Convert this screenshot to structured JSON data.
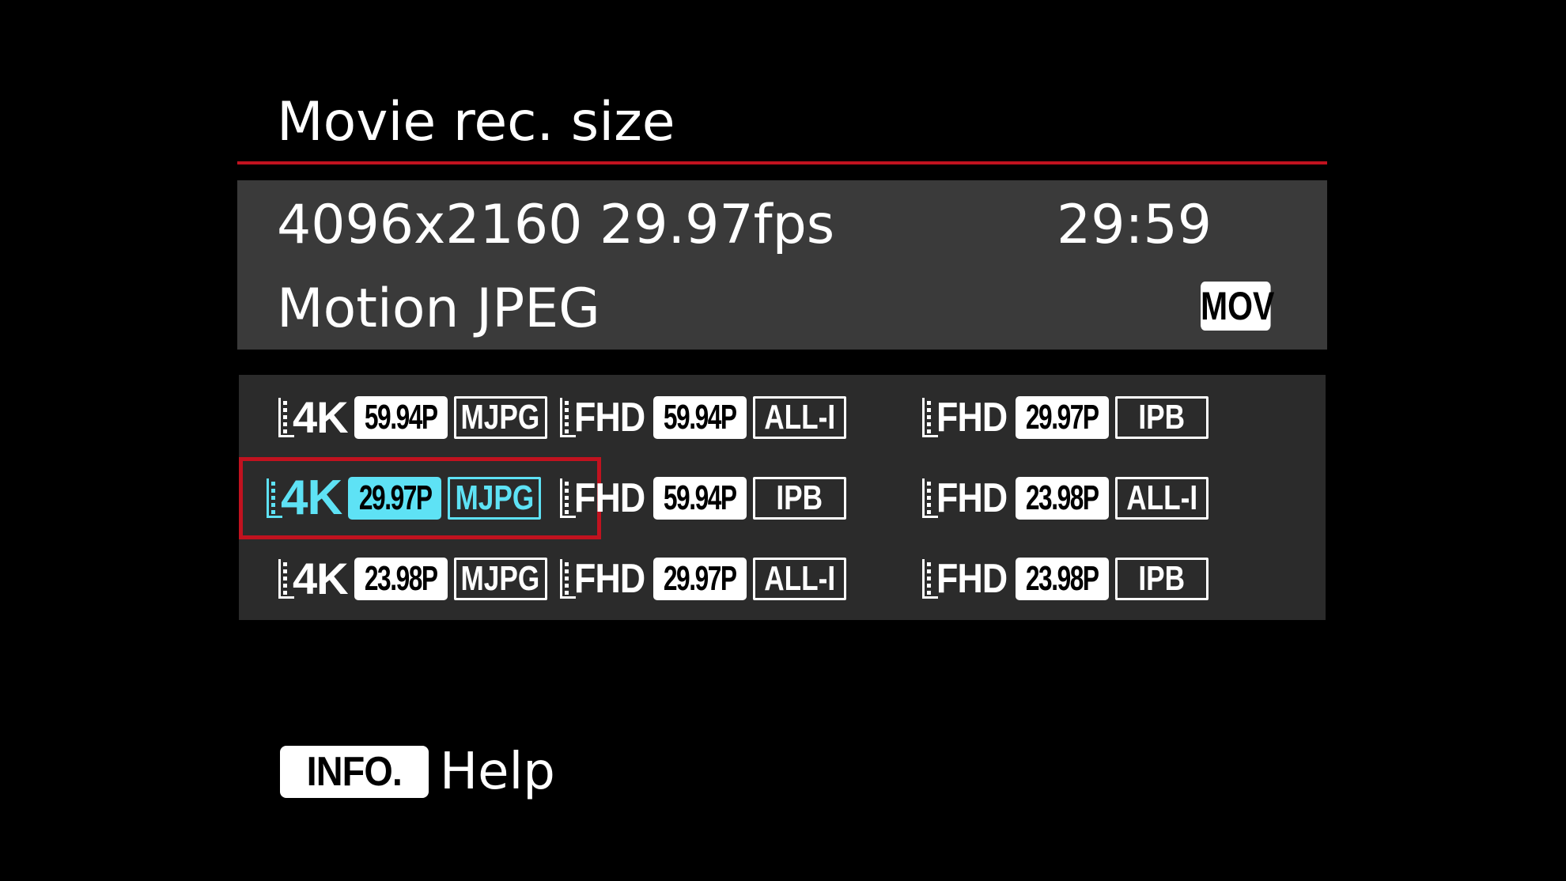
{
  "colors": {
    "background": "#000000",
    "accent_red": "#c1121f",
    "selected_cyan": "#5ee2f5",
    "info_panel": "#3a3a3a",
    "grid_panel": "#2b2b2b"
  },
  "header": {
    "title": "Movie rec. size"
  },
  "info_panel": {
    "resolution": "4096x2160 29.97fps",
    "time_remaining": "29:59",
    "codec": "Motion JPEG",
    "container": "MOV"
  },
  "options": [
    {
      "id": "opt-4k-5994-mjpg",
      "resolution": "4K",
      "frame_rate": "59.94P",
      "compression": "MJPG",
      "selected": false,
      "icon": "film-frame-icon"
    },
    {
      "id": "opt-fhd-5994-alli",
      "resolution": "FHD",
      "frame_rate": "59.94P",
      "compression": "ALL-I",
      "selected": false,
      "icon": "film-frame-icon"
    },
    {
      "id": "opt-fhd-2997-ipb",
      "resolution": "FHD",
      "frame_rate": "29.97P",
      "compression": "IPB",
      "selected": false,
      "icon": "film-frame-icon"
    },
    {
      "id": "opt-4k-2997-mjpg",
      "resolution": "4K",
      "frame_rate": "29.97P",
      "compression": "MJPG",
      "selected": true,
      "icon": "film-frame-icon"
    },
    {
      "id": "opt-fhd-5994-ipb",
      "resolution": "FHD",
      "frame_rate": "59.94P",
      "compression": "IPB",
      "selected": false,
      "icon": "film-frame-icon"
    },
    {
      "id": "opt-fhd-2398-alli",
      "resolution": "FHD",
      "frame_rate": "23.98P",
      "compression": "ALL-I",
      "selected": false,
      "icon": "film-frame-icon"
    },
    {
      "id": "opt-4k-2398-mjpg",
      "resolution": "4K",
      "frame_rate": "23.98P",
      "compression": "MJPG",
      "selected": false,
      "icon": "film-frame-icon"
    },
    {
      "id": "opt-fhd-2997-alli",
      "resolution": "FHD",
      "frame_rate": "29.97P",
      "compression": "ALL-I",
      "selected": false,
      "icon": "film-frame-icon"
    },
    {
      "id": "opt-fhd-2398-ipb",
      "resolution": "FHD",
      "frame_rate": "23.98P",
      "compression": "IPB",
      "selected": false,
      "icon": "film-frame-icon"
    }
  ],
  "footer": {
    "info_button_label": "INFO.",
    "help_label": "Help"
  }
}
